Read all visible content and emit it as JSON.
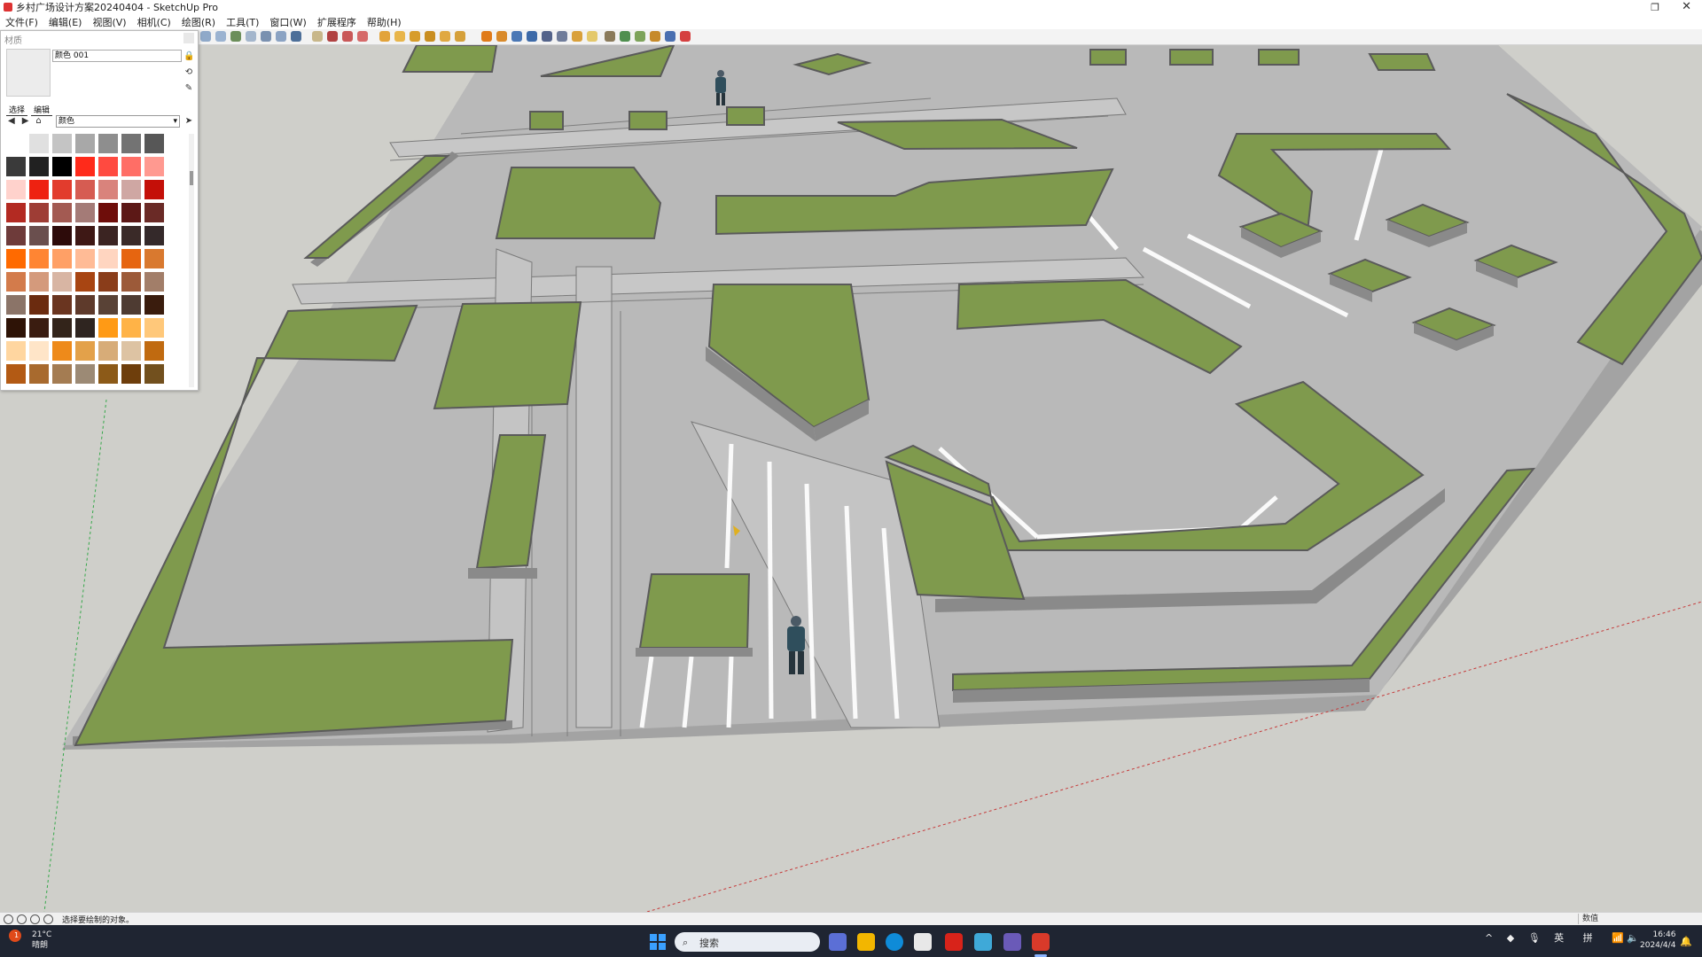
{
  "window": {
    "title": "乡村广场设计方案20240404 - SketchUp Pro",
    "restore_glyph": "❐",
    "close_glyph": "✕"
  },
  "menu": {
    "items": [
      "文件(F)",
      "编辑(E)",
      "视图(V)",
      "相机(C)",
      "绘图(R)",
      "工具(T)",
      "窗口(W)",
      "扩展程序",
      "帮助(H)"
    ]
  },
  "materials_panel": {
    "title": "材质",
    "material_name": "颜色 001",
    "tabs": [
      "选择",
      "编辑"
    ],
    "nav_icons": [
      "back-arrow",
      "forward-arrow",
      "home"
    ],
    "nav_glyphs": [
      "◀",
      "▶",
      "⌂"
    ],
    "library": "颜色",
    "side_glyphs": [
      "🔒",
      "⟲",
      "✎",
      "➤"
    ],
    "swatch_rows": [
      [
        "#ffffff",
        "#e0e0e0",
        "#c4c4c4",
        "#a8a8a8",
        "#8e8e8e",
        "#737373",
        "#575757"
      ],
      [
        "#3a3a3a",
        "#212121",
        "#000000",
        "#ff2a1a",
        "#ff4a40",
        "#ff6e66",
        "#ff9990"
      ],
      [
        "#ffd2cc",
        "#ee2211",
        "#e23c2d",
        "#d65c52",
        "#d9837c",
        "#cfa7a3",
        "#c40f08"
      ],
      [
        "#b32a22",
        "#9e3d35",
        "#a35a52",
        "#a47b77",
        "#6e0d0a",
        "#5c1816",
        "#6a2a26"
      ],
      [
        "#6e3b3a",
        "#6a4f4e",
        "#2d0b0a",
        "#3e1815",
        "#3b2422",
        "#3a2a28",
        "#34292a"
      ],
      [
        "#ff6a00",
        "#ff8533",
        "#ffa066",
        "#ffbb96",
        "#ffd5c0",
        "#e66510",
        "#d9792f"
      ],
      [
        "#d37b4b",
        "#d49a7c",
        "#d8b5a3",
        "#a84512",
        "#8a3d1a",
        "#9c5a39",
        "#a27e69"
      ],
      [
        "#8b7468",
        "#6b2b0f",
        "#6a3520",
        "#5e3a2b",
        "#594236",
        "#4e3b32",
        "#3a1c0d"
      ],
      [
        "#2e1306",
        "#3a1c10",
        "#33241a",
        "#2f2520",
        "#ff9a15",
        "#ffb347",
        "#ffc87a"
      ],
      [
        "#ffd6a0",
        "#ffe5c8",
        "#ee8a1a",
        "#e3a14a",
        "#d7ac78",
        "#ddc3a3",
        "#c06a10"
      ],
      [
        "#b35a14",
        "#a86a2e",
        "#a47c52",
        "#9c8a75",
        "#8c5a18",
        "#6e3e0c",
        "#72501e"
      ]
    ]
  },
  "status": {
    "hint": "选择要绘制的对象。",
    "measurements_label": "数值"
  },
  "taskbar": {
    "weather_temp": "21°C",
    "weather_desc": "晴朗",
    "weather_badge": "1",
    "search_placeholder": "搜索",
    "search_glyph": "⌕",
    "tray_glyphs": [
      "^",
      "◆",
      "🎙"
    ],
    "ime_lang": "英",
    "ime_mode": "拼",
    "tray_icons_glyph": "📶 🔈",
    "bell_glyph": "🔔",
    "time": "16:46",
    "date": "2024/4/4"
  }
}
